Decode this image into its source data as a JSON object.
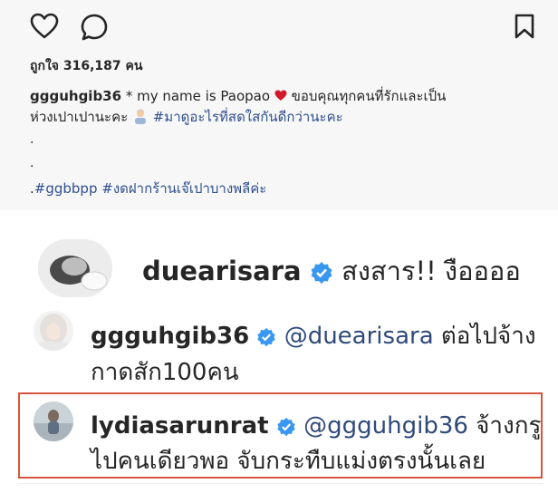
{
  "post": {
    "likes_text": "ถูกใจ 316,187 คน",
    "caption": {
      "username": "ggguhgib36",
      "line1_text": " * my name is Paopao ",
      "line1_after_heart": " ขอบคุณทุกคนที่รักและเป็น",
      "line2_text": "ห่วงเปาเปานะคะ ",
      "line2_tag": "#มาดูอะไรที่สดใสกันดีกว่านะคะ",
      "dot1": ".",
      "dot2": ".",
      "line3_prefix": ".",
      "line3_tags": "#ggbbpp #งดฝากร้านเจ๊เปาบางพลีค่ะ"
    }
  },
  "comments": [
    {
      "username": "duearisara",
      "text": " สงสาร!! งืออออ"
    },
    {
      "username": "ggguhgib36",
      "mention": "@duearisara",
      "text_line1": " ต่อไปจ้าง",
      "text_line2": "กาดสัก100คน"
    },
    {
      "username": "lydiasarunrat",
      "mention": "@ggguhgib36",
      "text_line1": " จ้างกรู",
      "text_line2": "ไปคนเดียวพอ จับกระทืบแม่งตรงนั้นเลย"
    }
  ],
  "icons": {
    "like": "heart-icon",
    "comment": "comment-icon",
    "save": "bookmark-icon",
    "verified": "verified-badge-icon",
    "heart_emoji": "red-heart-icon",
    "emoji": "person-emoji-icon"
  },
  "colors": {
    "highlight_border": "#d9543e",
    "verified_blue": "#3897f0",
    "mention": "#2f4a7a",
    "heart_red": "#d11a2a"
  }
}
